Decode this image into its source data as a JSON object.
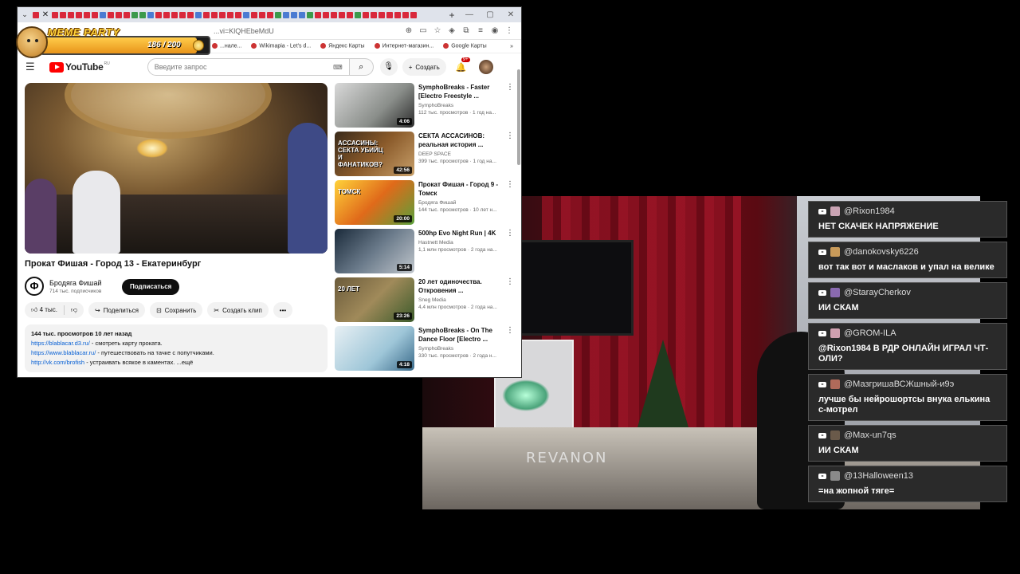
{
  "meme": {
    "title": "MEME PARTY",
    "count": "186 / 200",
    "progress": 0.93
  },
  "browser": {
    "tabs_text": "",
    "bookmarks": [
      "...нале...",
      "Wikimapia - Let's d...",
      "Яндекс Карты",
      "Интернет-магазин...",
      "Google Карты"
    ],
    "url_fragment": "...vi=KlQHEbeMdU"
  },
  "youtube": {
    "logo": "YouTube",
    "region": "RU",
    "search_placeholder": "Введите запрос",
    "create_label": "Создать",
    "notifications": "9+",
    "video_title": "Прокат Фишая - Город 13 - Екатеринбург",
    "channel_name": "Бродяга Фишай",
    "channel_subs": "714 тыс. подписчиков",
    "subscribe_label": "Подписаться",
    "likes": "4 тыс.",
    "share_label": "Поделиться",
    "save_label": "Сохранить",
    "clip_label": "Создать клип",
    "description": {
      "stats": "144 тыс. просмотров  10 лет назад",
      "lines": [
        {
          "link": "https://blablacar.d3.ru/",
          "text": " - смотреть карту проката."
        },
        {
          "link": "https://www.blablacar.ru/",
          "text": " - путешествовать на тачке с попутчиками."
        },
        {
          "link": "http://vk.com/brofish",
          "text": " - устраивать всякое в каментах.  ...ещё"
        }
      ]
    },
    "recommendations": [
      {
        "title": "SymphoBreaks - Faster [Electro Freestyle ...",
        "channel": "SymphoBreaks",
        "meta": "112 тыс. просмотров · 1 год на...",
        "duration": "4:06",
        "bg": "linear-gradient(135deg,#d9d9d9,#8a8e8a 60%,#2a2a2a)"
      },
      {
        "title": "СЕКТА АССАСИНОВ: реальная история ...",
        "channel": "DEEP SPACE",
        "meta": "399 тыс. просмотров · 1 год на...",
        "duration": "42:56",
        "bg": "linear-gradient(135deg,#3a2a1a,#8a5a2a 50%,#c8a06a)",
        "overlay": "АССАСИНЫ: СЕКТА УБИЙЦ И ФАНАТИКОВ?"
      },
      {
        "title": "Прокат Фишая - Город 9 - Томск",
        "channel": "Бродяга Фишай",
        "meta": "144 тыс. просмотров · 10 лет н...",
        "duration": "20:00",
        "bg": "linear-gradient(135deg,#ffd23a,#e06a1a 50%,#5aa03a)",
        "overlay": "ТОМСК"
      },
      {
        "title": "500hp Evo Night Run | 4K",
        "channel": "Hastnett Media",
        "meta": "1,1 млн просмотров · 2 года на...",
        "duration": "5:14",
        "bg": "linear-gradient(135deg,#1a2a3a,#6a7a8a 50%,#c0c6cc)"
      },
      {
        "title": "20 лет одиночества. Откровения ...",
        "channel": "Sneg Media",
        "meta": "4,4 млн просмотров · 2 года на...",
        "duration": "23:26",
        "bg": "linear-gradient(135deg,#6a5a3a,#a08a5a 50%,#3a5a2a)",
        "overlay": "20 ЛЕТ"
      },
      {
        "title": "SymphoBreaks - On The Dance Floor [Electro ...",
        "channel": "SymphoBreaks",
        "meta": "330 тыс. просмотров · 2 года н...",
        "duration": "4:18",
        "bg": "linear-gradient(135deg,#e8f0f4,#9ec6d8 60%,#3a6a8a)"
      }
    ]
  },
  "chat": [
    {
      "user": "@Rixon1984",
      "text": "НЕТ СКАЧЕК НАПРЯЖЕНИЕ",
      "avatar": "#c9a3b3"
    },
    {
      "user": "@danokovsky6226",
      "text": "вот так вот и маслаков и упал на велике",
      "avatar": "#c89a5a"
    },
    {
      "user": "@StarayCherkov",
      "text": "ИИ СКАМ",
      "avatar": "#8a6ab0"
    },
    {
      "user": "@GROM-ILA",
      "text": "@Rixon1984 В РДР ОНЛАЙН ИГРАЛ ЧТ-ОЛИ?",
      "avatar": "#d0a0b0"
    },
    {
      "user": "@МазгришаВСЖшный-и9э",
      "text": "лучше бы нейрошортсы внука елькина с-мотрел",
      "avatar": "#b06a5a"
    },
    {
      "user": "@Max-un7qs",
      "text": "ИИ СКАМ",
      "avatar": "#6a5a4a"
    },
    {
      "user": "@13Halloween13",
      "text": "=на жопной тяге=",
      "avatar": "#8a8a8a"
    }
  ],
  "webcam": {
    "brand": "REVANON"
  }
}
